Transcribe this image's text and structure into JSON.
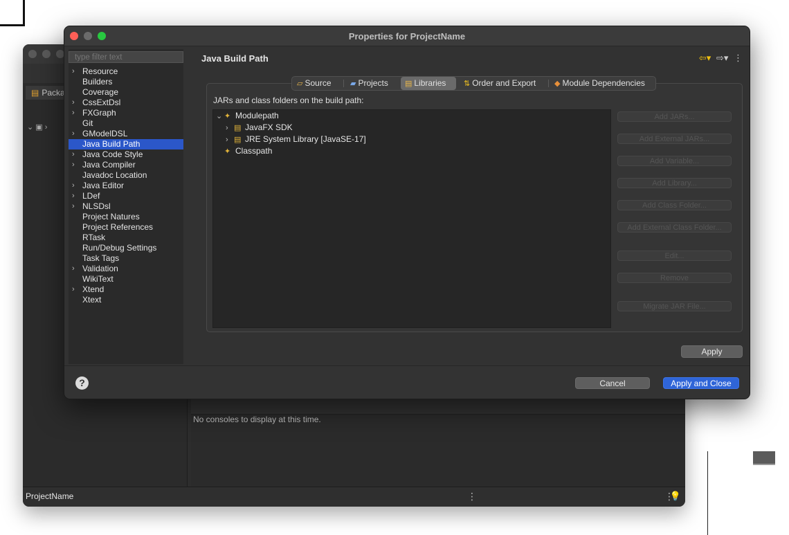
{
  "background_window": {
    "tab_label": "Packa",
    "console_message": "No consoles to display at this time.",
    "status_project": "ProjectName"
  },
  "dialog": {
    "title": "Properties for ProjectName",
    "filter_placeholder": "type filter text",
    "categories": [
      {
        "label": "Resource",
        "expandable": true
      },
      {
        "label": "Builders",
        "expandable": false
      },
      {
        "label": "Coverage",
        "expandable": false
      },
      {
        "label": "CssExtDsl",
        "expandable": true
      },
      {
        "label": "FXGraph",
        "expandable": true
      },
      {
        "label": "Git",
        "expandable": false
      },
      {
        "label": "GModelDSL",
        "expandable": true
      },
      {
        "label": "Java Build Path",
        "expandable": false,
        "selected": true
      },
      {
        "label": "Java Code Style",
        "expandable": true
      },
      {
        "label": "Java Compiler",
        "expandable": true
      },
      {
        "label": "Javadoc Location",
        "expandable": false
      },
      {
        "label": "Java Editor",
        "expandable": true
      },
      {
        "label": "LDef",
        "expandable": true
      },
      {
        "label": "NLSDsl",
        "expandable": true
      },
      {
        "label": "Project Natures",
        "expandable": false
      },
      {
        "label": "Project References",
        "expandable": false
      },
      {
        "label": "RTask",
        "expandable": false
      },
      {
        "label": "Run/Debug Settings",
        "expandable": false
      },
      {
        "label": "Task Tags",
        "expandable": false
      },
      {
        "label": "Validation",
        "expandable": true
      },
      {
        "label": "WikiText",
        "expandable": false
      },
      {
        "label": "Xtend",
        "expandable": true
      },
      {
        "label": "Xtext",
        "expandable": false
      }
    ],
    "page_title": "Java Build Path",
    "tabs": [
      {
        "label": "Source",
        "icon": "source-folder-icon"
      },
      {
        "label": "Projects",
        "icon": "projects-icon"
      },
      {
        "label": "Libraries",
        "icon": "libraries-icon",
        "selected": true
      },
      {
        "label": "Order and Export",
        "icon": "order-export-icon"
      },
      {
        "label": "Module Dependencies",
        "icon": "module-dependencies-icon"
      }
    ],
    "group_label": "JARs and class folders on the build path:",
    "tree": {
      "modulepath": "Modulepath",
      "javafx": "JavaFX SDK",
      "jre": "JRE System Library [JavaSE-17]",
      "classpath": "Classpath"
    },
    "side_buttons": [
      "Add JARs...",
      "Add External JARs...",
      "Add Variable...",
      "Add Library...",
      "Add Class Folder...",
      "Add External Class Folder...",
      "Edit...",
      "Remove",
      "Migrate JAR File..."
    ],
    "apply_label": "Apply",
    "cancel_label": "Cancel",
    "apply_close_label": "Apply and Close",
    "help_glyph": "?"
  },
  "colors": {
    "selection": "#2b57c9",
    "primary_button": "#2f65d8",
    "close_light": "#fe5f57",
    "zoom_light": "#28c840"
  }
}
